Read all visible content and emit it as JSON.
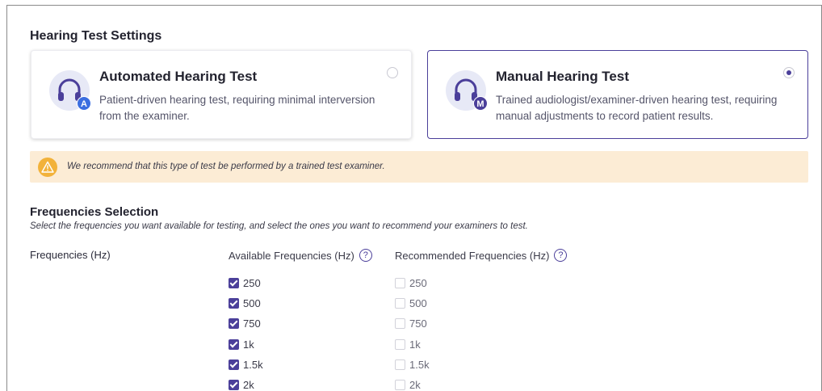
{
  "settings": {
    "title": "Hearing Test Settings"
  },
  "options": [
    {
      "title": "Automated Hearing Test",
      "badge": "A",
      "description": "Patient-driven hearing test, requiring minimal interversion from the examiner.",
      "selected": false
    },
    {
      "title": "Manual Hearing Test",
      "badge": "M",
      "description": "Trained audiologist/examiner-driven hearing test, requiring manual adjustments to record patient results.",
      "selected": true
    }
  ],
  "banner": {
    "text": "We recommend that this type of test be performed by a trained test examiner."
  },
  "frequencies": {
    "title": "Frequencies Selection",
    "subtitle": "Select the frequencies you want available for testing, and select the ones you want to recommend your examiners to test.",
    "row_label": "Frequencies (Hz)",
    "available_header": "Available Frequencies (Hz)",
    "recommended_header": "Recommended Frequencies (Hz)",
    "help_glyph": "?",
    "available": [
      {
        "label": "250",
        "checked": true
      },
      {
        "label": "500",
        "checked": true
      },
      {
        "label": "750",
        "checked": true
      },
      {
        "label": "1k",
        "checked": true
      },
      {
        "label": "1.5k",
        "checked": true
      },
      {
        "label": "2k",
        "checked": true
      }
    ],
    "recommended": [
      {
        "label": "250",
        "checked": false
      },
      {
        "label": "500",
        "checked": false
      },
      {
        "label": "750",
        "checked": false
      },
      {
        "label": "1k",
        "checked": false
      },
      {
        "label": "1.5k",
        "checked": false
      },
      {
        "label": "2k",
        "checked": false
      }
    ]
  },
  "colors": {
    "accent": "#4b3f9a",
    "warning_bg": "#fcecd5",
    "warning_icon": "#f2b23a"
  }
}
